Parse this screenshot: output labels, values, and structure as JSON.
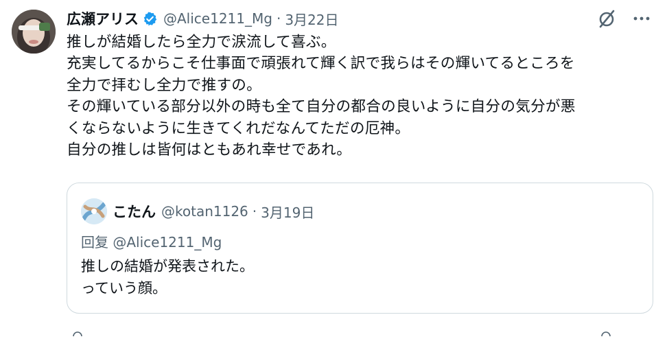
{
  "author": {
    "display_name": "広瀬アリス",
    "handle": "@Alice1211_Mg",
    "separator": "·",
    "date": "3月22日",
    "verified_icon": "verified-badge-icon"
  },
  "actions": {
    "grok_icon": "slash-circle-icon",
    "more_icon": "more-dots-icon",
    "more_label": "···"
  },
  "tweet": {
    "lines": [
      "推しが結婚したら全力で涙流して喜ぶ。",
      "充実してるからこそ仕事面で頑張れて輝く訳で我らはその輝いてるところを",
      "全力で拝むし全力で推すの。",
      "その輝いている部分以外の時も全て自分の都合の良いように自分の気分が悪",
      "くならないように生きてくれだなんてただの厄神。",
      "自分の推しは皆何はともあれ幸せであれ。"
    ]
  },
  "quoted": {
    "display_name": "こたん",
    "handle": "@kotan1126",
    "separator": "·",
    "date": "3月19日",
    "reply_to": "回复 @Alice1211_Mg",
    "lines": [
      "推しの結婚が発表された。",
      "っていう顔。"
    ]
  },
  "colors": {
    "text": "#0f1419",
    "secondary": "#536471",
    "border": "#cfd9de",
    "verified": "#1d9bf0"
  }
}
